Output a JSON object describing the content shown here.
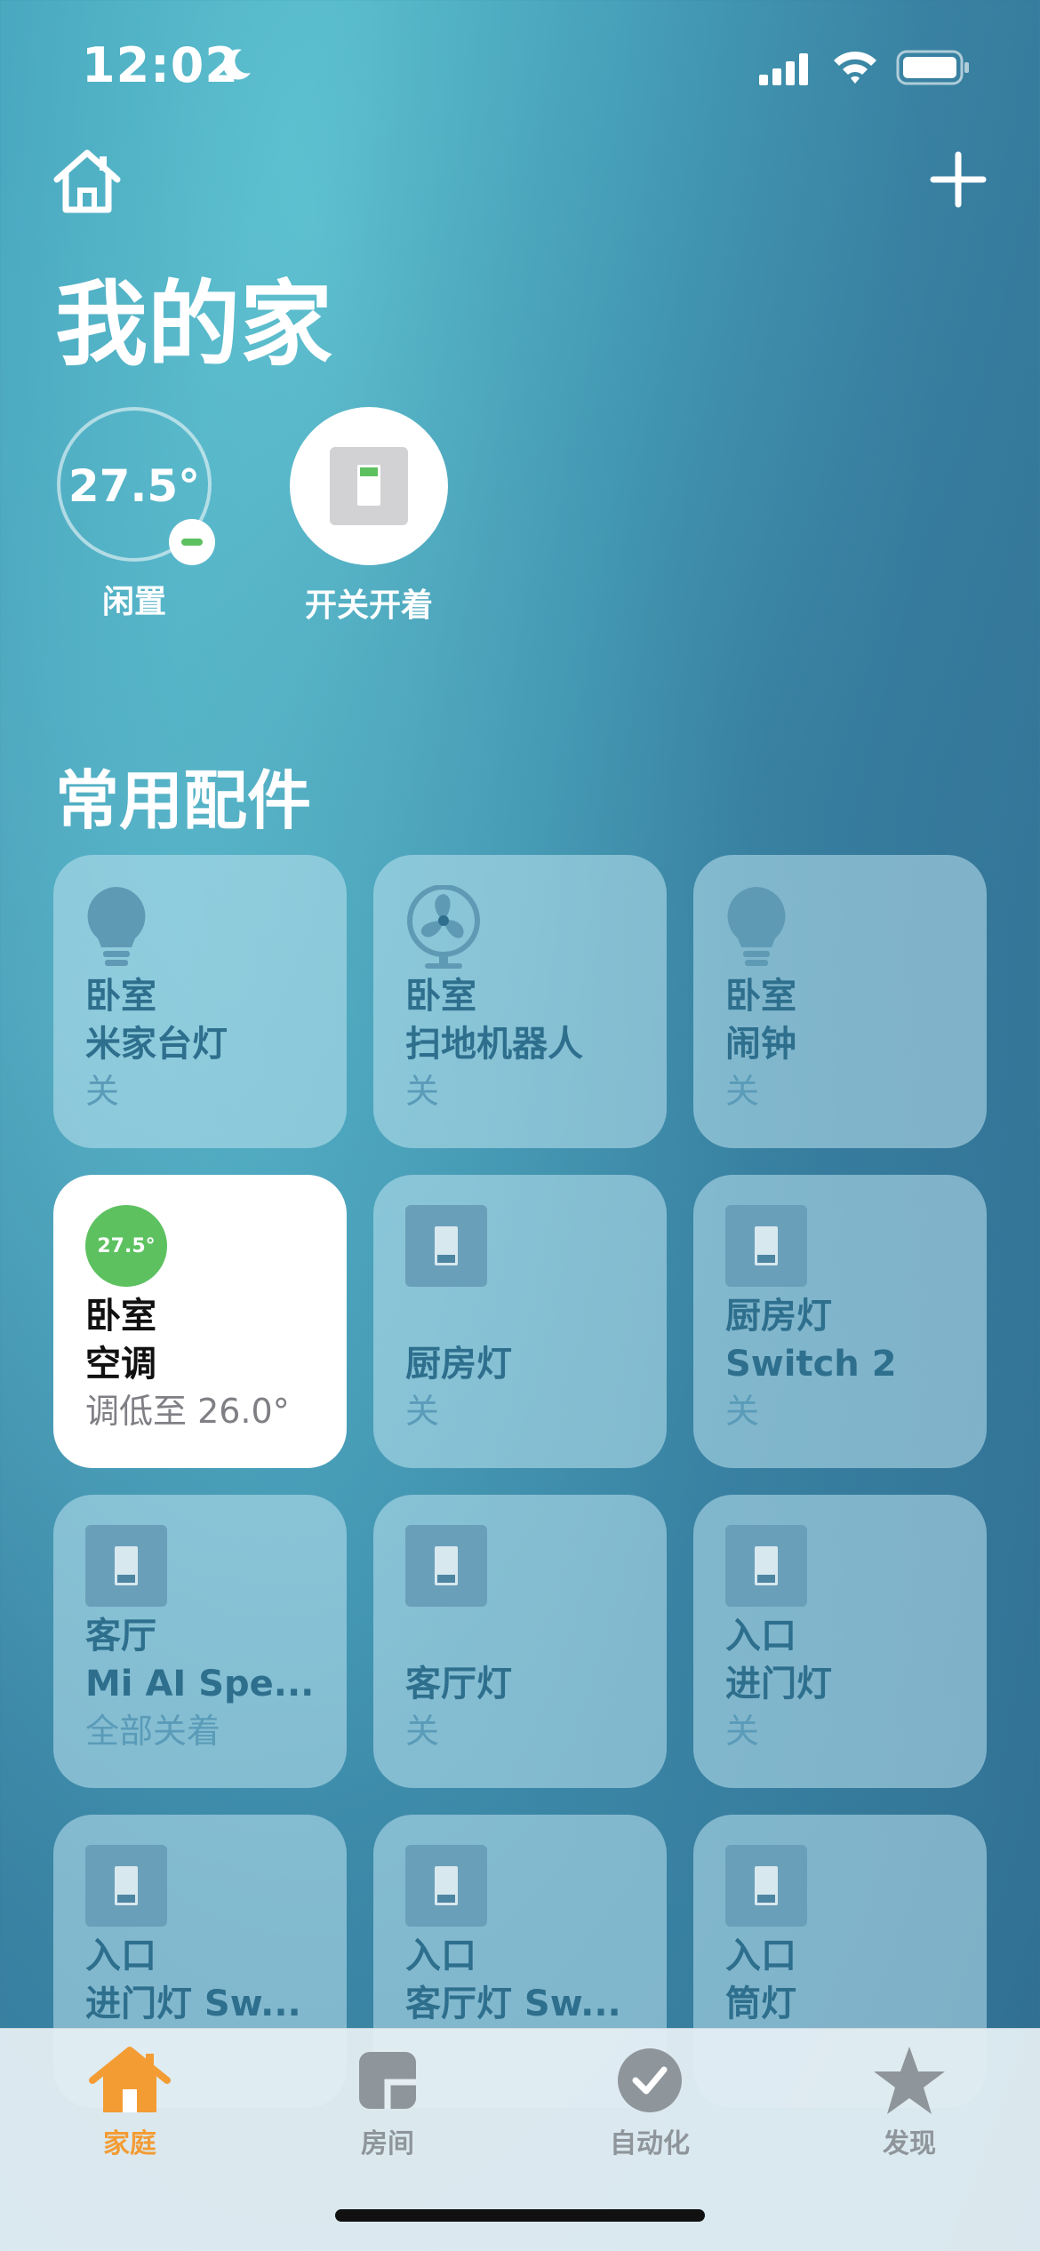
{
  "status_bar": {
    "time": "12:02"
  },
  "header": {
    "title": "我的家"
  },
  "summary": [
    {
      "value": "27.5°",
      "label": "闲置"
    },
    {
      "label": "开关开着"
    }
  ],
  "section": {
    "title": "常用配件"
  },
  "tiles": [
    {
      "icon": "lightbulb-icon",
      "room": "卧室",
      "name": "米家台灯",
      "state": "关"
    },
    {
      "icon": "fan-icon",
      "room": "卧室",
      "name": "扫地机器人",
      "state": "关"
    },
    {
      "icon": "lightbulb-icon",
      "room": "卧室",
      "name": "闹钟",
      "state": "关"
    },
    {
      "icon": "thermostat-icon",
      "badge": "27.5°",
      "room": "卧室",
      "name": "空调",
      "state": "调低至 26.0°",
      "active": true
    },
    {
      "icon": "switch-icon",
      "room": "",
      "name": "厨房灯",
      "state": "关"
    },
    {
      "icon": "switch-icon",
      "room": "厨房灯",
      "name": "Switch 2",
      "state": "关"
    },
    {
      "icon": "switch-icon",
      "room": "客厅",
      "name": "Mi AI Spe...",
      "state": "全部关着"
    },
    {
      "icon": "switch-icon",
      "room": "",
      "name": "客厅灯",
      "state": "关"
    },
    {
      "icon": "switch-icon",
      "room": "入口",
      "name": "进门灯",
      "state": "关"
    },
    {
      "icon": "switch-icon",
      "room": "入口",
      "name": "进门灯 Sw...",
      "state": ""
    },
    {
      "icon": "switch-icon",
      "room": "入口",
      "name": "客厅灯 Sw...",
      "state": ""
    },
    {
      "icon": "switch-icon",
      "room": "入口",
      "name": "筒灯",
      "state": ""
    }
  ],
  "tabs": [
    {
      "label": "家庭",
      "icon": "house-icon",
      "selected": true
    },
    {
      "label": "房间",
      "icon": "rooms-icon",
      "selected": false
    },
    {
      "label": "自动化",
      "icon": "automation-icon",
      "selected": false
    },
    {
      "label": "发现",
      "icon": "star-icon",
      "selected": false
    }
  ],
  "colors": {
    "accent": "#f39c34",
    "on_green": "#5dc160",
    "tile_text": "#2e6f8d"
  }
}
